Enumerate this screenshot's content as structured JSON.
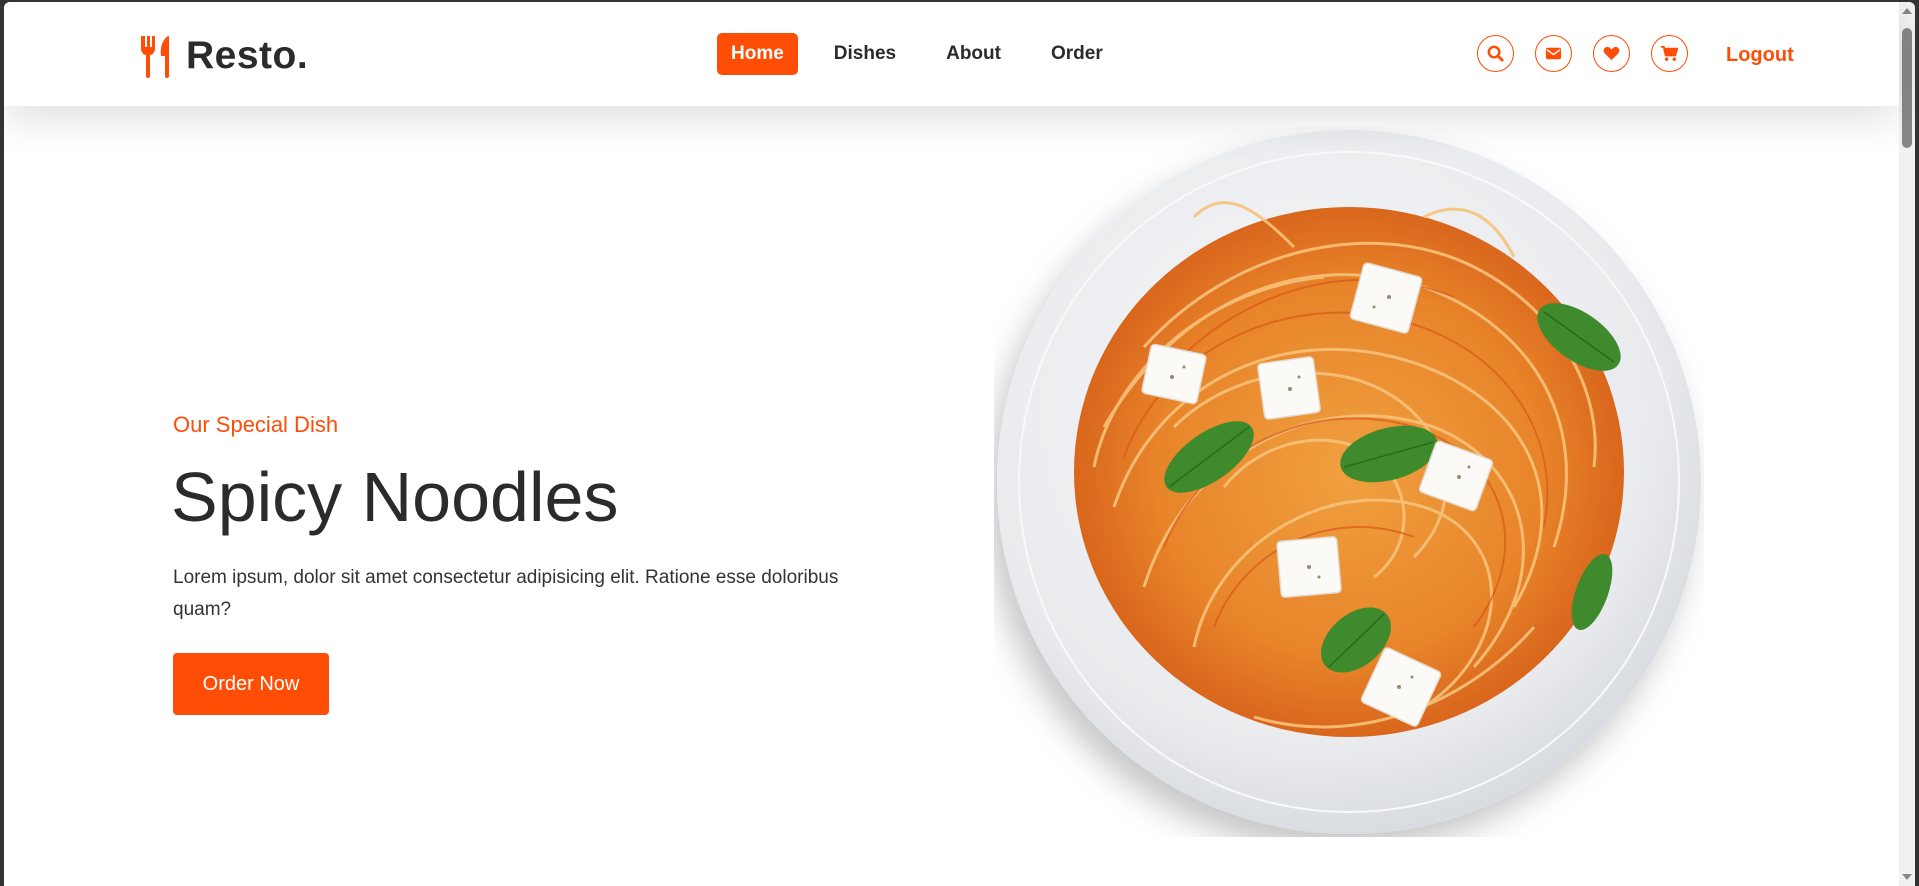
{
  "brand": {
    "name": "Resto.",
    "accent": "#ff4d06",
    "icon": "utensils-icon"
  },
  "nav": [
    {
      "label": "Home",
      "active": true
    },
    {
      "label": "Dishes",
      "active": false
    },
    {
      "label": "About",
      "active": false
    },
    {
      "label": "Order",
      "active": false
    }
  ],
  "header_icons": [
    "search-icon",
    "envelope-icon",
    "heart-icon",
    "cart-icon"
  ],
  "logout_label": "Logout",
  "hero": {
    "subtitle": "Our Special Dish",
    "title": "Spicy Noodles",
    "description": "Lorem ipsum, dolor sit amet consectetur adipisicing elit. Ratione esse doloribus quam?",
    "button_label": "Order Now"
  }
}
